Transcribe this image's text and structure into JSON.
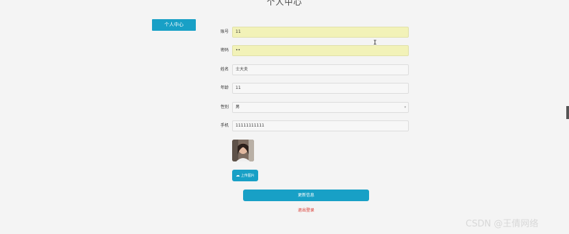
{
  "page": {
    "title": "个人中心"
  },
  "sidebar": {
    "items": [
      {
        "label": "个人中心"
      }
    ]
  },
  "form": {
    "fields": [
      {
        "label": "账号",
        "value": "11",
        "autofill": true
      },
      {
        "label": "密码",
        "value": "••",
        "autofill": true
      },
      {
        "label": "姓名",
        "value": "士大夫"
      },
      {
        "label": "年龄",
        "value": "11"
      },
      {
        "label": "性别",
        "value": "男",
        "type": "select"
      },
      {
        "label": "手机",
        "value": "11111111111"
      }
    ],
    "upload_button": "上传图片",
    "upload_icon": "cloud-upload-icon",
    "update_button": "更新信息",
    "logout_link": "退出登录"
  },
  "watermark": "CSDN @王倩网络",
  "colors": {
    "primary": "#18a0c6",
    "autofill": "#f2f2b8",
    "danger": "#d9342b",
    "background": "#f4f4f4"
  }
}
